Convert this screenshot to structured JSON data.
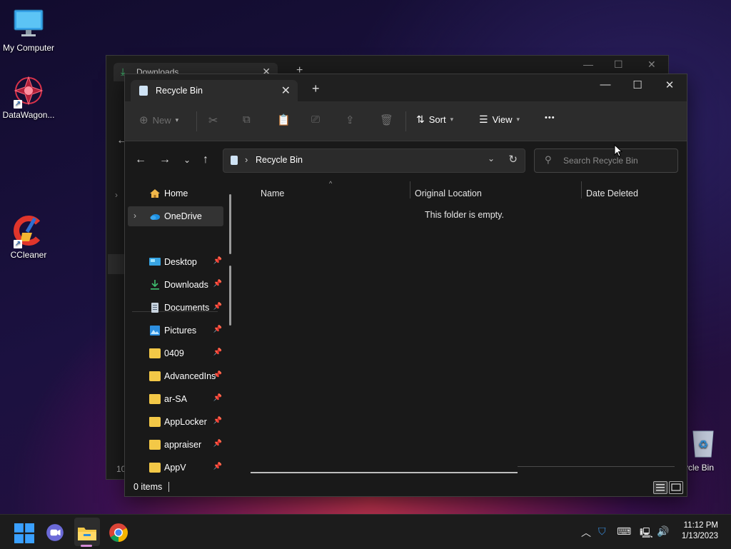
{
  "desktop": {
    "icons": [
      {
        "label": "My Computer"
      },
      {
        "label": "DataWagon..."
      },
      {
        "label": "CCleaner"
      },
      {
        "label": "ycle Bin"
      }
    ]
  },
  "background_window": {
    "tab_title": "Downloads",
    "status_fragment": "10"
  },
  "window": {
    "tab_title": "Recycle Bin",
    "new_tab": "+",
    "controls": {
      "minimize": "—",
      "maximize": "☐",
      "close": "✕"
    }
  },
  "command_bar": {
    "new_label": "New",
    "sort_label": "Sort",
    "view_label": "View",
    "more_label": "•••"
  },
  "address_bar": {
    "path": "Recycle Bin",
    "search_placeholder": "Search Recycle Bin"
  },
  "sidebar": {
    "top_items": [
      {
        "label": "Home"
      },
      {
        "label": "OneDrive"
      }
    ],
    "pinned_items": [
      {
        "label": "Desktop"
      },
      {
        "label": "Downloads"
      },
      {
        "label": "Documents"
      },
      {
        "label": "Pictures"
      },
      {
        "label": "0409"
      },
      {
        "label": "AdvancedIns"
      },
      {
        "label": "ar-SA"
      },
      {
        "label": "AppLocker"
      },
      {
        "label": "appraiser"
      },
      {
        "label": "AppV"
      }
    ]
  },
  "content": {
    "columns": [
      "Name",
      "Original Location",
      "Date Deleted"
    ],
    "empty_message": "This folder is empty."
  },
  "status_bar": {
    "item_count": "0 items"
  },
  "taskbar": {
    "time": "11:12 PM",
    "date": "1/13/2023"
  },
  "colors": {
    "accent": "#0078d4",
    "folder": "#f3c847",
    "window_bg": "#191919"
  }
}
